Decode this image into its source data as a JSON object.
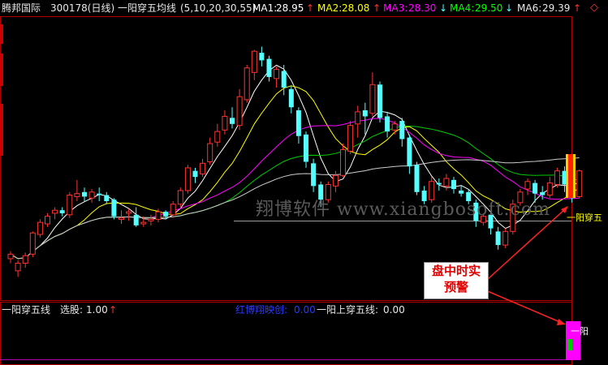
{
  "header": {
    "stock_name": "腾邦国际",
    "stock_code": "300178(日线)",
    "indicator_name": "一阳穿五均线",
    "indicator_params": "(5,10,20,30,55)",
    "ma1_label": "MA1:",
    "ma1_value": "28.95",
    "ma1_arrow": "↑",
    "ma2_label": "MA2:",
    "ma2_value": "28.08",
    "ma2_arrow": "↑",
    "ma3_label": "MA3:",
    "ma3_value": "28.30",
    "ma3_arrow": "↓",
    "ma4_label": "MA4:",
    "ma4_value": "29.50",
    "ma4_arrow": "↓",
    "ma6_label": "MA6:",
    "ma6_value": "29.39",
    "ma6_arrow": "↑",
    "menu_icon": "diamond-icon"
  },
  "sub_header": {
    "indicator_name": "一阳穿五线",
    "select_label": "选股:",
    "select_value": "1.00",
    "select_arrow": "↑",
    "red_label": "红博翔映创:",
    "red_value": "0.00",
    "cross_label": "一阳上穿五线:",
    "cross_value": "0.00"
  },
  "watermark": "翔博软件  www.xiangbosoft.com",
  "callout": {
    "line1": "盘中时实",
    "line2": "预警"
  },
  "signal_label": "一阳穿五",
  "sub_signal_text": "一阳",
  "colors": {
    "up": "#ff3333",
    "down": "#54ffff",
    "ma1": "#ffffff",
    "ma2": "#ffff00",
    "ma3": "#ff00ff",
    "ma4": "#00cc00",
    "ma6": "#cccccc",
    "border": "#b00000"
  },
  "chart_data": {
    "type": "candlestick",
    "series": [
      {
        "name": "MA1",
        "values": []
      },
      {
        "name": "MA2",
        "values": []
      },
      {
        "name": "MA3",
        "values": []
      },
      {
        "name": "MA4",
        "values": []
      },
      {
        "name": "MA6",
        "values": []
      }
    ],
    "candles": [
      [
        25.2,
        25.5,
        24.9,
        25.7
      ],
      [
        24.4,
        24.9,
        24.0,
        25.1
      ],
      [
        24.9,
        25.4,
        24.6,
        25.6
      ],
      [
        25.5,
        26.9,
        25.3,
        27.0
      ],
      [
        26.8,
        27.6,
        26.6,
        27.8
      ],
      [
        27.5,
        28.0,
        27.3,
        28.2
      ],
      [
        28.2,
        28.4,
        27.8,
        28.6
      ],
      [
        28.4,
        28.2,
        28.0,
        28.6
      ],
      [
        28.1,
        29.4,
        27.9,
        29.6
      ],
      [
        29.3,
        29.5,
        29.0,
        30.4
      ],
      [
        29.6,
        29.3,
        29.0,
        29.9
      ],
      [
        29.2,
        29.6,
        28.9,
        29.8
      ],
      [
        29.5,
        29.4,
        29.0,
        29.9
      ],
      [
        29.4,
        29.0,
        28.8,
        29.6
      ],
      [
        29.1,
        28.0,
        27.8,
        29.2
      ],
      [
        27.8,
        27.9,
        27.5,
        28.4
      ],
      [
        28.2,
        28.3,
        27.7,
        28.5
      ],
      [
        28.1,
        27.4,
        27.3,
        28.6
      ],
      [
        27.5,
        27.6,
        27.3,
        28.0
      ],
      [
        27.7,
        27.8,
        27.4,
        28.1
      ],
      [
        27.8,
        28.3,
        27.6,
        28.5
      ],
      [
        28.3,
        28.0,
        27.8,
        28.4
      ],
      [
        28.1,
        28.8,
        27.9,
        29.0
      ],
      [
        28.8,
        29.7,
        28.6,
        29.9
      ],
      [
        29.7,
        31.2,
        29.5,
        31.4
      ],
      [
        31.0,
        30.6,
        30.2,
        31.2
      ],
      [
        30.8,
        31.5,
        30.6,
        31.8
      ],
      [
        31.6,
        32.8,
        31.4,
        33.2
      ],
      [
        32.9,
        33.6,
        32.6,
        34.1
      ],
      [
        33.7,
        34.6,
        33.4,
        35.0
      ],
      [
        34.5,
        34.1,
        33.8,
        35.2
      ],
      [
        34.0,
        35.9,
        33.7,
        36.4
      ],
      [
        35.7,
        37.8,
        35.5,
        38.0
      ],
      [
        37.5,
        38.9,
        37.0,
        39.0
      ],
      [
        38.8,
        38.3,
        37.9,
        39.2
      ],
      [
        38.4,
        37.2,
        36.9,
        38.6
      ],
      [
        37.1,
        37.7,
        36.5,
        37.9
      ],
      [
        37.6,
        36.5,
        36.0,
        38.0
      ],
      [
        36.4,
        35.2,
        34.8,
        36.6
      ],
      [
        35.0,
        33.3,
        32.8,
        35.2
      ],
      [
        33.4,
        31.6,
        31.2,
        33.6
      ],
      [
        31.5,
        30.0,
        29.6,
        31.8
      ],
      [
        30.1,
        29.1,
        28.6,
        30.3
      ],
      [
        29.1,
        30.1,
        28.9,
        30.3
      ],
      [
        30.0,
        30.7,
        29.6,
        31.0
      ],
      [
        30.7,
        32.4,
        30.6,
        32.8
      ],
      [
        32.3,
        34.0,
        32.1,
        34.3
      ],
      [
        34.1,
        34.9,
        33.2,
        35.3
      ],
      [
        35.0,
        34.6,
        33.4,
        35.5
      ],
      [
        34.8,
        36.7,
        34.6,
        37.5
      ],
      [
        36.7,
        34.5,
        34.2,
        36.9
      ],
      [
        34.6,
        33.6,
        33.2,
        34.9
      ],
      [
        33.7,
        34.1,
        33.4,
        34.3
      ],
      [
        34.3,
        33.1,
        32.6,
        34.5
      ],
      [
        33.2,
        31.3,
        30.8,
        33.4
      ],
      [
        31.4,
        29.6,
        29.4,
        31.6
      ],
      [
        29.7,
        29.0,
        28.8,
        30.0
      ],
      [
        29.1,
        30.3,
        28.9,
        30.6
      ],
      [
        30.2,
        30.1,
        29.7,
        30.5
      ],
      [
        30.0,
        30.5,
        29.7,
        30.8
      ],
      [
        30.4,
        29.8,
        29.5,
        30.6
      ],
      [
        29.7,
        29.5,
        29.3,
        30.0
      ],
      [
        29.6,
        29.0,
        28.8,
        29.8
      ],
      [
        28.9,
        27.7,
        27.3,
        29.1
      ],
      [
        27.6,
        28.0,
        27.4,
        28.2
      ],
      [
        28.1,
        27.2,
        26.8,
        28.3
      ],
      [
        27.0,
        26.1,
        25.8,
        27.3
      ],
      [
        26.1,
        27.0,
        25.9,
        27.2
      ],
      [
        27.0,
        28.8,
        26.8,
        29.1
      ],
      [
        28.9,
        29.6,
        28.7,
        29.8
      ],
      [
        29.8,
        30.3,
        29.4,
        30.5
      ],
      [
        30.2,
        29.5,
        28.9,
        30.4
      ],
      [
        29.6,
        29.4,
        29.1,
        30.0
      ],
      [
        29.4,
        30.2,
        29.2,
        30.6
      ],
      [
        30.1,
        31.0,
        29.9,
        31.2
      ],
      [
        31.0,
        30.1,
        29.6,
        31.3
      ],
      [
        30.0,
        29.2,
        28.9,
        30.3
      ],
      [
        29.3,
        31.0,
        29.2,
        31.1
      ]
    ]
  }
}
